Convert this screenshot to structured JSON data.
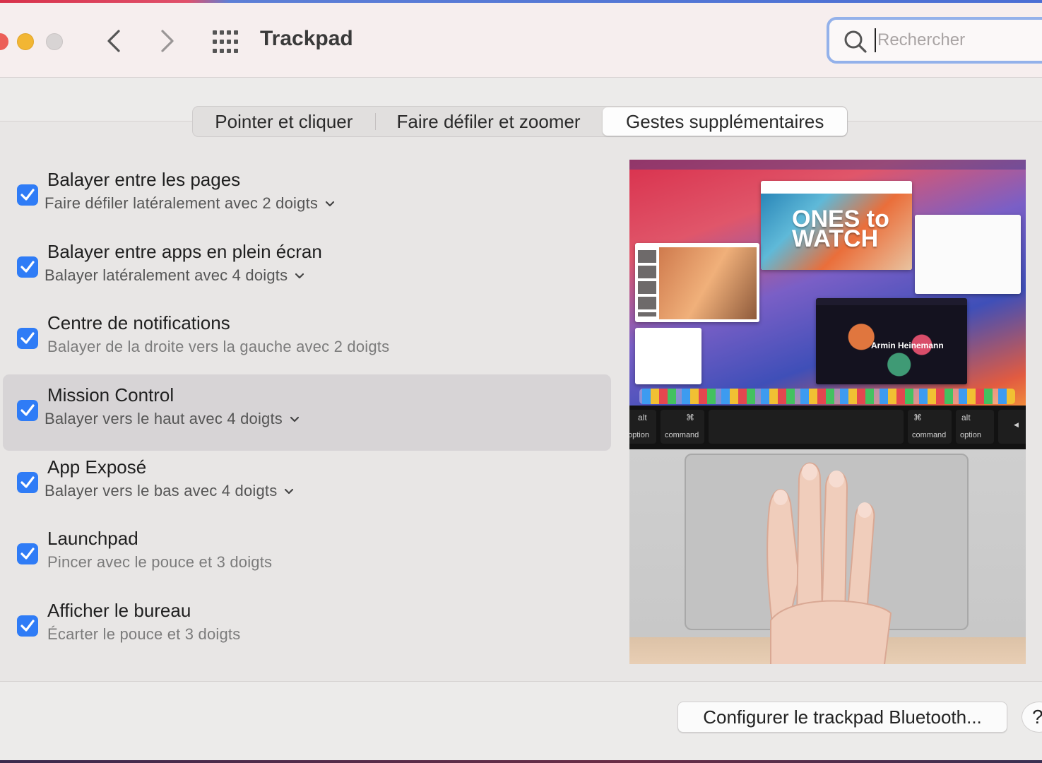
{
  "window": {
    "title": "Trackpad"
  },
  "search": {
    "placeholder": "Rechercher",
    "value": ""
  },
  "tabs": [
    {
      "label": "Pointer et cliquer",
      "selected": false
    },
    {
      "label": "Faire défiler et zoomer",
      "selected": false
    },
    {
      "label": "Gestes supplémentaires",
      "selected": true
    }
  ],
  "options": [
    {
      "title": "Balayer entre les pages",
      "subtitle": "Faire défiler latéralement avec 2 doigts",
      "checked": true,
      "has_dropdown": true
    },
    {
      "title": "Balayer entre apps en plein écran",
      "subtitle": "Balayer latéralement avec 4 doigts",
      "checked": true,
      "has_dropdown": true
    },
    {
      "title": "Centre de notifications",
      "subtitle": "Balayer de la droite vers la gauche avec 2 doigts",
      "checked": true,
      "has_dropdown": false
    },
    {
      "title": "Mission Control",
      "subtitle": "Balayer vers le haut avec 4 doigts",
      "checked": true,
      "has_dropdown": true,
      "highlighted": true
    },
    {
      "title": "App Exposé",
      "subtitle": "Balayer vers le bas avec 4 doigts",
      "checked": true,
      "has_dropdown": true
    },
    {
      "title": "Launchpad",
      "subtitle": "Pincer avec le pouce et 3 doigts",
      "checked": true,
      "has_dropdown": false
    },
    {
      "title": "Afficher le bureau",
      "subtitle": "Écarter le pouce et 3 doigts",
      "checked": true,
      "has_dropdown": false
    }
  ],
  "preview": {
    "poster_text": "ONES to WATCH",
    "artist_text": "Armin Heinemann",
    "keys": [
      {
        "symbol": "alt",
        "label": "option"
      },
      {
        "symbol": "⌘",
        "label": "command"
      },
      {
        "symbol": "",
        "label": ""
      },
      {
        "symbol": "⌘",
        "label": "command"
      },
      {
        "symbol": "alt",
        "label": "option"
      },
      {
        "symbol": "◀",
        "label": ""
      }
    ]
  },
  "footer": {
    "configure_label": "Configurer le trackpad Bluetooth...",
    "help_label": "?"
  },
  "colors": {
    "accent": "#2f7cf6",
    "search_focus": "#93b1ea",
    "selected_row": "#d7d4d6"
  }
}
